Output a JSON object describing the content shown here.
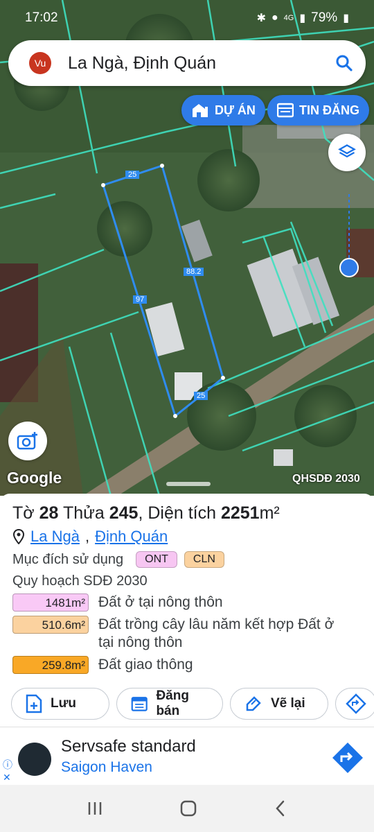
{
  "status_bar": {
    "time": "17:02",
    "network": "4G",
    "battery": "79%"
  },
  "search": {
    "avatar": "Vu",
    "query": "La Ngà, Định Quán",
    "icon": "search-icon"
  },
  "map_buttons": {
    "du_an": "DỰ ÁN",
    "tin_dang": "TIN ĐĂNG"
  },
  "map": {
    "attribution": "Google",
    "layer_label": "QHSDĐ 2030",
    "plot_edges": {
      "top": "25",
      "right": "88.2",
      "left": "97",
      "bottom": "25"
    }
  },
  "parcel": {
    "to_label": "Tờ",
    "to": "28",
    "thua_label": "Thửa",
    "thua": "245",
    "dien_tich_label": ", Diện tích",
    "dien_tich": "2251",
    "unit": "m²",
    "ward": "La Ngà",
    "district": "Định Quán",
    "purpose_label": "Mục đích sử dụng",
    "purposes": [
      {
        "code": "ONT",
        "color": "#f7c6f2"
      },
      {
        "code": "CLN",
        "color": "#fbd29f"
      }
    ],
    "plan_label": "Quy hoạch SDĐ 2030",
    "plan_rows": [
      {
        "area": "1481m²",
        "desc": "Đất ở tại nông thôn",
        "color": "#f9c9f6"
      },
      {
        "area": "510.6m²",
        "desc": "Đất trồng cây lâu năm kết hợp Đất ở tại nông thôn",
        "color": "#fbd29f"
      },
      {
        "area": "259.8m²",
        "desc": "Đất giao thông",
        "color": "#f9a826"
      }
    ]
  },
  "actions": {
    "save": "Lưu",
    "sell": "Đăng bán",
    "redraw": "Vẽ lại"
  },
  "ad": {
    "title": "Servsafe standard",
    "advertiser": "Saigon Haven"
  }
}
